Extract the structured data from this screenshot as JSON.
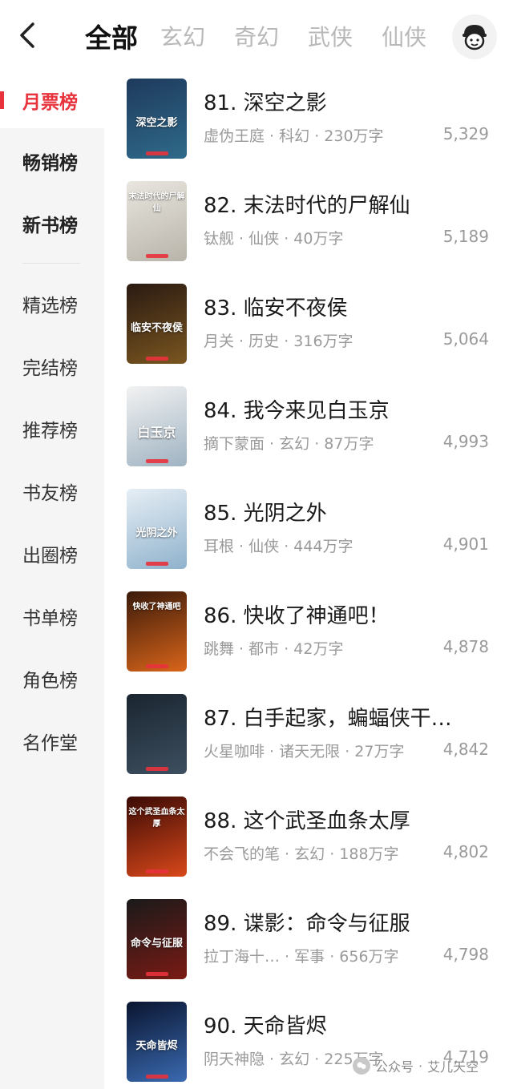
{
  "header": {
    "tabs": [
      "全部",
      "玄幻",
      "奇幻",
      "武侠",
      "仙侠"
    ],
    "icons": {
      "back": "back-chevron-icon",
      "avatar": "user-avatar-icon"
    }
  },
  "sidebar": {
    "items": [
      "月票榜",
      "畅销榜",
      "新书榜",
      "精选榜",
      "完结榜",
      "推荐榜",
      "书友榜",
      "出圈榜",
      "书单榜",
      "角色榜",
      "名作堂"
    ],
    "active_index": 0
  },
  "books": [
    {
      "title": "81. 深空之影",
      "author": "虚伪王庭",
      "genre": "科幻",
      "words": "230万字",
      "votes": "5,329",
      "cover_text": "深空之影",
      "cover_colors": [
        "#1e3a5c",
        "#2f6a8a"
      ]
    },
    {
      "title": "82. 末法时代的尸解仙",
      "author": "钛舰",
      "genre": "仙侠",
      "words": "40万字",
      "votes": "5,189",
      "cover_text": "末法时代的尸解仙",
      "cover_colors": [
        "#e9e6df",
        "#b8b4aa"
      ]
    },
    {
      "title": "83. 临安不夜侯",
      "author": "月关",
      "genre": "历史",
      "words": "316万字",
      "votes": "5,064",
      "cover_text": "临安不夜侯",
      "cover_colors": [
        "#2a1a12",
        "#7a5620"
      ]
    },
    {
      "title": "84. 我今来见白玉京",
      "author": "摘下蒙面",
      "genre": "玄幻",
      "words": "87万字",
      "votes": "4,993",
      "cover_text": "白玉京",
      "cover_colors": [
        "#f2f2f2",
        "#9fb3c2"
      ]
    },
    {
      "title": "85. 光阴之外",
      "author": "耳根",
      "genre": "仙侠",
      "words": "444万字",
      "votes": "4,901",
      "cover_text": "光阴之外",
      "cover_colors": [
        "#e6eef5",
        "#8fb2cc"
      ]
    },
    {
      "title": "86. 快收了神通吧！",
      "author": "跳舞",
      "genre": "都市",
      "words": "42万字",
      "votes": "4,878",
      "cover_text": "快收了神通吧",
      "cover_colors": [
        "#3a1a0a",
        "#d9651a"
      ]
    },
    {
      "title": "87. 白手起家，蝙蝠侠干…",
      "author": "火星咖啡",
      "genre": "诸天无限",
      "words": "27万字",
      "votes": "4,842",
      "cover_text": "",
      "cover_colors": [
        "#1a2530",
        "#3d4f60"
      ]
    },
    {
      "title": "88. 这个武圣血条太厚",
      "author": "不会飞的笔",
      "genre": "玄幻",
      "words": "188万字",
      "votes": "4,802",
      "cover_text": "这个武圣血条太厚",
      "cover_colors": [
        "#3a0a05",
        "#d9481a"
      ]
    },
    {
      "title": "89. 谍影：命令与征服",
      "author": "拉丁海十…",
      "genre": "军事",
      "words": "656万字",
      "votes": "4,798",
      "cover_text": "命令与征服",
      "cover_colors": [
        "#1a1a1a",
        "#7a1a14"
      ]
    },
    {
      "title": "90. 天命皆烬",
      "author": "阴天神隐",
      "genre": "玄幻",
      "words": "225万字",
      "votes": "4,719",
      "cover_text": "天命皆烬",
      "cover_colors": [
        "#0a1530",
        "#3a6ab0"
      ]
    }
  ],
  "meta_separator": " · ",
  "watermark": {
    "source": "公众号",
    "separator": "·",
    "author": "艾儿天空"
  },
  "colors": {
    "accent": "#e8323c",
    "muted": "#9a9a9a",
    "sidebar_bg": "#f5f5f5"
  }
}
